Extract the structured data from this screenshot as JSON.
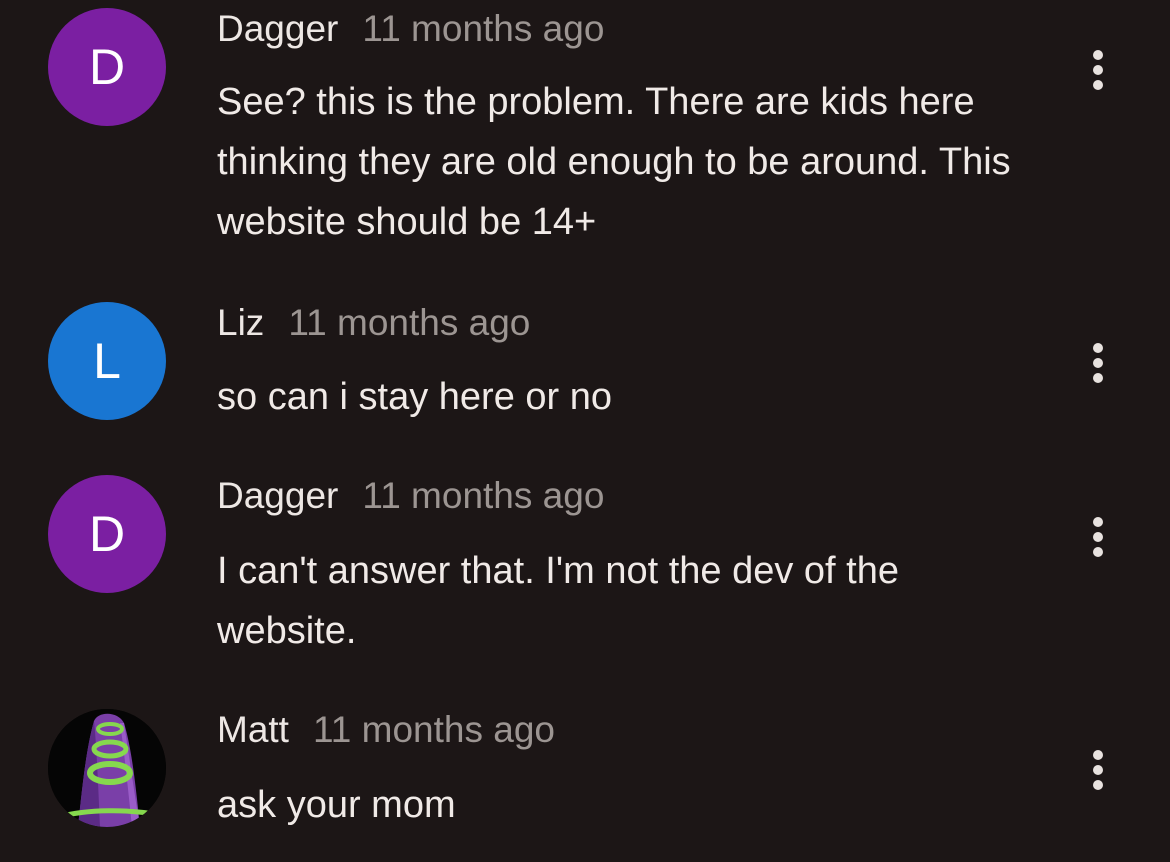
{
  "colors": {
    "background": "#1c1616",
    "avatar_purple": "#7b1fa2",
    "avatar_blue": "#1976d2"
  },
  "comments": [
    {
      "avatar_letter": "D",
      "author": "Dagger",
      "time": "11 months ago",
      "text": "See? this is the problem. There are kids here thinking they are old enough to be around. This website should be 14+",
      "more_icon": "more-vertical-icon"
    },
    {
      "avatar_letter": "L",
      "author": "Liz",
      "time": "11 months ago",
      "text": "so can i stay here or no",
      "more_icon": "more-vertical-icon"
    },
    {
      "avatar_letter": "D",
      "author": "Dagger",
      "time": "11 months ago",
      "text": "I can't answer that. I'm not the dev of the website.",
      "more_icon": "more-vertical-icon"
    },
    {
      "avatar_image": "purple-tentacle-avatar",
      "author": "Matt",
      "time": "11 months ago",
      "text": "ask your mom",
      "more_icon": "more-vertical-icon"
    }
  ]
}
